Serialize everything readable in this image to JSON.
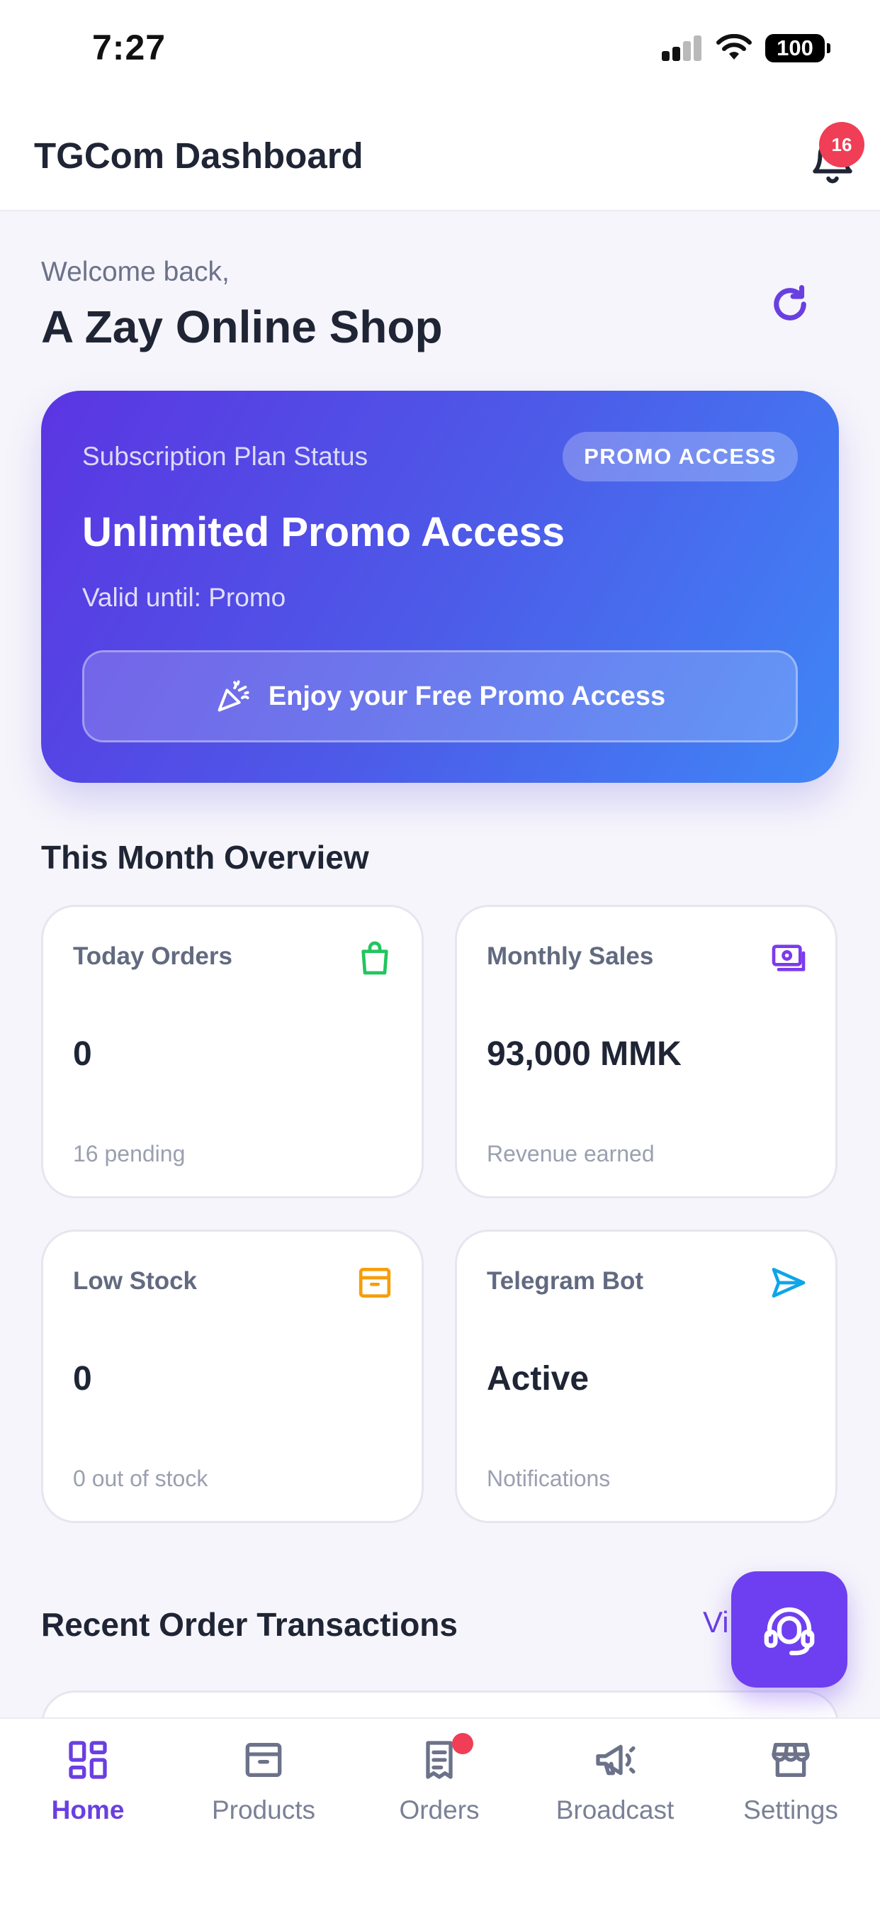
{
  "status_bar": {
    "time": "7:27",
    "battery": "100"
  },
  "header": {
    "title": "TGCom Dashboard",
    "notification_count": "16"
  },
  "welcome": {
    "greeting": "Welcome back,",
    "shop_name": "A Zay Online Shop"
  },
  "subscription": {
    "label": "Subscription Plan Status",
    "badge": "PROMO ACCESS",
    "plan": "Unlimited Promo Access",
    "valid_until": "Valid until: Promo",
    "button_label": "Enjoy your Free Promo Access"
  },
  "overview": {
    "title": "This Month Overview",
    "cards": [
      {
        "label": "Today Orders",
        "value": "0",
        "sub": "16 pending",
        "icon": "shopping-bag-icon",
        "color": "#22c55e"
      },
      {
        "label": "Monthly Sales",
        "value": "93,000 MMK",
        "sub": "Revenue earned",
        "icon": "cash-icon",
        "color": "#7c3aed"
      },
      {
        "label": "Low Stock",
        "value": "0",
        "sub": "0 out of stock",
        "icon": "archive-box-icon",
        "color": "#f59e0b"
      },
      {
        "label": "Telegram Bot",
        "value": "Active",
        "sub": "Notifications",
        "icon": "send-icon",
        "color": "#0ea5e9"
      }
    ]
  },
  "recent": {
    "title": "Recent Order Transactions",
    "view_all": "Vi"
  },
  "nav": {
    "items": [
      {
        "label": "Home",
        "icon": "grid-icon"
      },
      {
        "label": "Products",
        "icon": "archive-box-icon"
      },
      {
        "label": "Orders",
        "icon": "receipt-icon"
      },
      {
        "label": "Broadcast",
        "icon": "megaphone-icon"
      },
      {
        "label": "Settings",
        "icon": "store-icon"
      }
    ],
    "active": "Home"
  },
  "colors": {
    "accent": "#6a3fe0",
    "badge": "#ef3e56"
  }
}
